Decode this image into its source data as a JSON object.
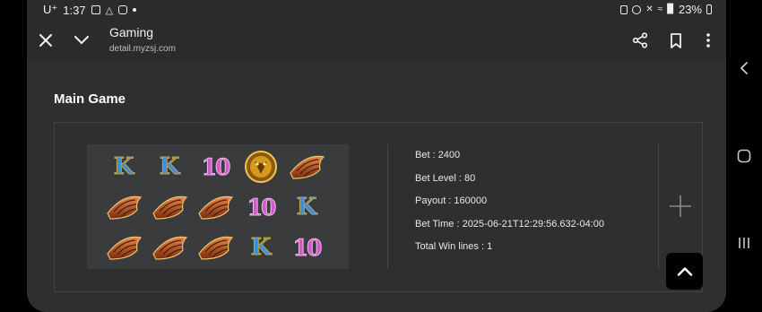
{
  "status_bar": {
    "carrier": "U⁺",
    "time": "1:37",
    "battery": "23%"
  },
  "toolbar": {
    "title": "Gaming",
    "url": "detail.myzsj.com"
  },
  "main": {
    "heading": "Main Game",
    "reels": [
      [
        "K",
        "K",
        "10",
        "wild",
        "ship"
      ],
      [
        "ship",
        "ship",
        "ship",
        "10",
        "K"
      ],
      [
        "ship",
        "ship",
        "ship",
        "K",
        "10"
      ]
    ],
    "info": {
      "bet": "Bet : 2400",
      "bet_level": "Bet Level : 80",
      "payout": "Payout : 160000",
      "bet_time": "Bet Time : 2025-06-21T12:29:56.632-04:00",
      "total_win_lines": "Total Win lines : 1"
    }
  },
  "colors": {
    "background": "#2f2f31",
    "card_border": "#434346",
    "k_symbol": "#3b8fe0",
    "ten_symbol": "#d05ac8",
    "ship_symbol": "#b5541c",
    "wild_symbol": "#d49a1a"
  },
  "icons": [
    "close-icon",
    "chevron-down-icon",
    "share-icon",
    "bookmark-icon",
    "more-vert-icon",
    "plus-icon",
    "chevron-up-icon",
    "nav-back-icon",
    "nav-home-icon",
    "nav-recents-icon"
  ]
}
